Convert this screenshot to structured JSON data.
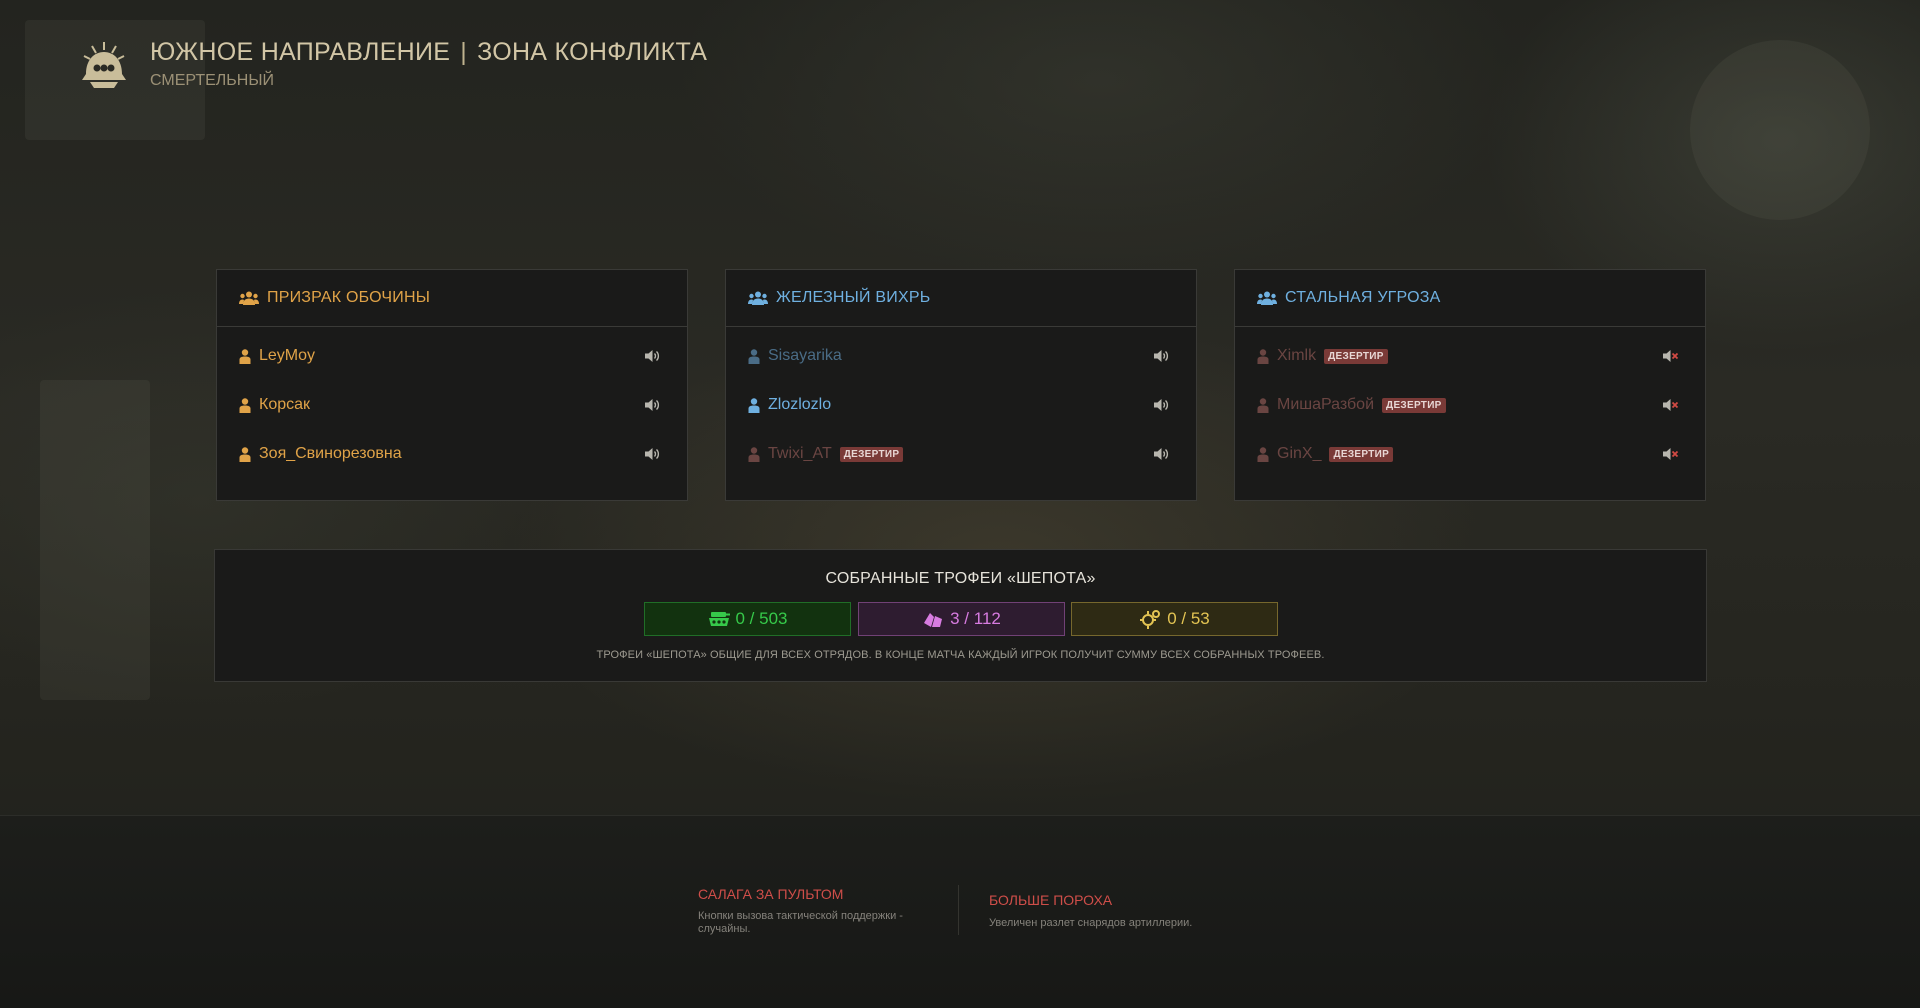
{
  "header": {
    "title_left": "ЮЖНОЕ НАПРАВЛЕНИЕ",
    "title_separator": "|",
    "title_right": "ЗОНА КОНФЛИКТА",
    "difficulty": "СМЕРТЕЛЬНЫЙ",
    "logo_icon": "skull-emblem-icon"
  },
  "squads": [
    {
      "name": "ПРИЗРАК ОБОЧИНЫ",
      "color": "#e0a348",
      "members": [
        {
          "name": "LeyMoy",
          "deserter": false,
          "muted": false,
          "dimmed": false
        },
        {
          "name": "Корсак",
          "deserter": false,
          "muted": false,
          "dimmed": false
        },
        {
          "name": "Зоя_Свинорезовна",
          "deserter": false,
          "muted": false,
          "dimmed": false
        }
      ]
    },
    {
      "name": "ЖЕЛЕЗНЫЙ ВИХРЬ",
      "color": "#6fb0e0",
      "members": [
        {
          "name": "Sisayarika",
          "deserter": false,
          "muted": false,
          "dimmed": true
        },
        {
          "name": "Zlozlozlo",
          "deserter": false,
          "muted": false,
          "dimmed": false
        },
        {
          "name": "Twixi_AT",
          "deserter": true,
          "muted": false,
          "dimmed": true
        }
      ]
    },
    {
      "name": "СТАЛЬНАЯ УГРОЗА",
      "color": "#6fb0e0",
      "members": [
        {
          "name": "Ximlk",
          "deserter": true,
          "muted": true,
          "dimmed": true
        },
        {
          "name": "МишаРазбой",
          "deserter": true,
          "muted": true,
          "dimmed": true
        },
        {
          "name": "GinX_",
          "deserter": true,
          "muted": true,
          "dimmed": true
        }
      ]
    }
  ],
  "deserter_label": "ДЕЗЕРТИР",
  "trophies": {
    "title": "СОБРАННЫЕ ТРОФЕИ «ШЕПОТА»",
    "items": [
      {
        "icon": "tank-trophy-icon",
        "value": "0 / 503",
        "color": "#36c94a",
        "bg": "#12320f"
      },
      {
        "icon": "crystal-trophy-icon",
        "value": "3 / 112",
        "color": "#d77be0",
        "bg": "#2e1c30"
      },
      {
        "icon": "gear-trophy-icon",
        "value": "0 / 53",
        "color": "#e3c453",
        "bg": "#2e2a14"
      }
    ],
    "note": "ТРОФЕИ «ШЕПОТА» ОБЩИЕ ДЛЯ ВСЕХ ОТРЯДОВ. В КОНЦЕ МАТЧА КАЖДЫЙ ИГРОК ПОЛУЧИТ СУММУ ВСЕХ СОБРАННЫХ ТРОФЕЕВ."
  },
  "modifiers": [
    {
      "name": "САЛАГА ЗА ПУЛЬТОМ",
      "description": "Кнопки вызова тактической поддержки - случайны."
    },
    {
      "name": "БОЛЬШЕ ПОРОХА",
      "description": "Увеличен разлет снарядов артиллерии."
    }
  ]
}
